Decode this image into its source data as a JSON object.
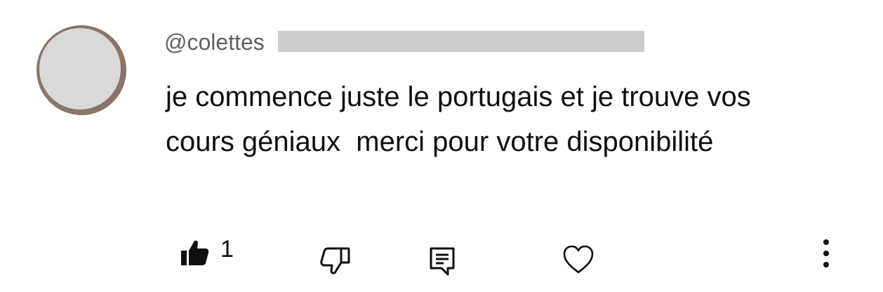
{
  "comment": {
    "username": "@colettes",
    "text": "je commence juste le portugais et je trouve vos cours géniaux  merci pour votre disponibilité"
  },
  "actions": {
    "like_count": "1",
    "like_icon": "thumbs-up-filled-icon",
    "dislike_icon": "thumbs-down-icon",
    "reply_icon": "reply-comment-icon",
    "heart_icon": "heart-icon",
    "more_icon": "more-vertical-icon"
  },
  "colors": {
    "avatar_ring": "#8c7467",
    "avatar_fill": "#d9d9d9",
    "username": "#606060",
    "text": "#0f0f0f",
    "redaction": "#cccccc"
  }
}
